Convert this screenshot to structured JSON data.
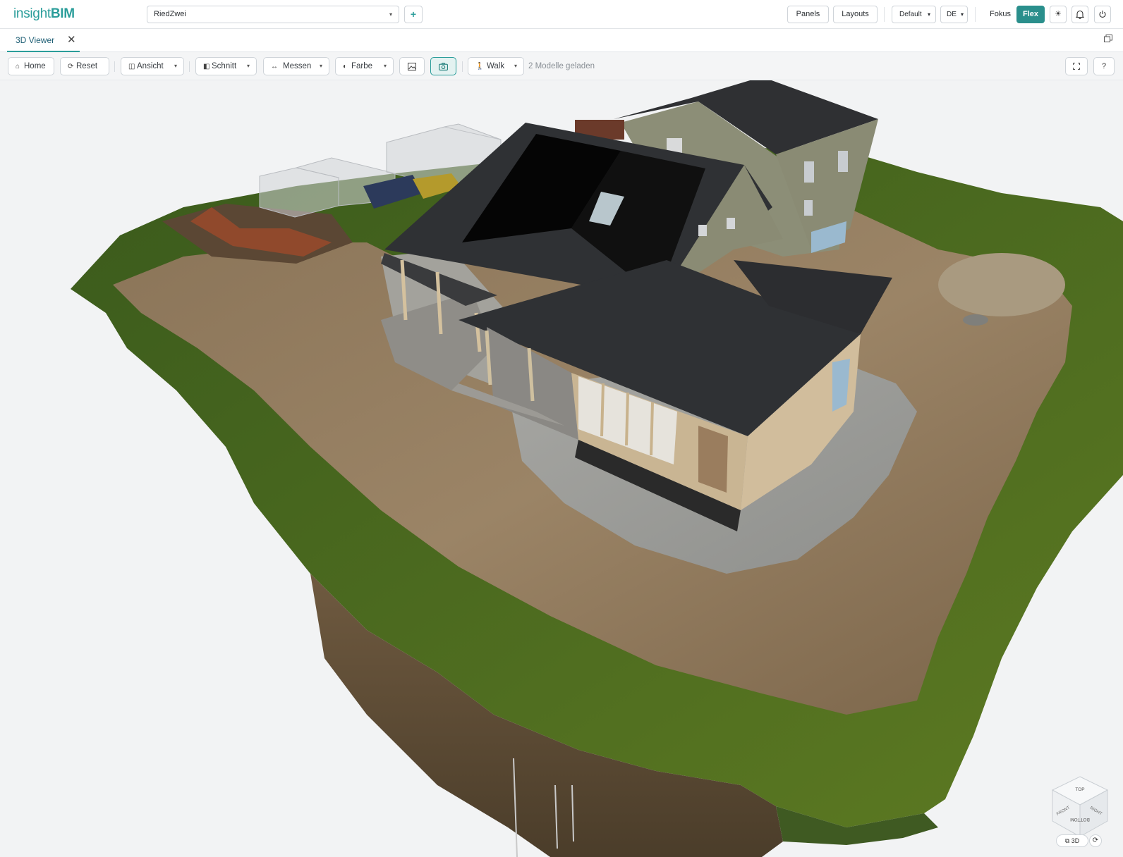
{
  "app": {
    "logo_part1": "insight",
    "logo_part2": "BIM"
  },
  "header": {
    "project_value": "RiedZwei",
    "add_label": "+",
    "panels_label": "Panels",
    "layouts_label": "Layouts",
    "layout_value": "Default",
    "language_value": "DE",
    "mode_fokus": "Fokus",
    "mode_flex": "Flex",
    "icons": [
      "add-icon",
      "theme-sun-icon",
      "bell-icon",
      "power-icon"
    ],
    "accent_color": "#2a9d9a",
    "active_color": "#2a8f8c"
  },
  "tabs": [
    {
      "label": "3D Viewer",
      "active": true
    }
  ],
  "toolbar": {
    "home_label": "Home",
    "reset_label": "Reset",
    "ansicht_label": "Ansicht",
    "schnitt_label": "Schnitt",
    "messen_label": "Messen",
    "farbe_label": "Farbe",
    "walk_label": "Walk",
    "status": "2 Modelle geladen",
    "icons": [
      "home-icon",
      "reset-icon",
      "view-icon",
      "section-icon",
      "measure-icon",
      "color-icon",
      "image-icon",
      "camera-icon",
      "walk-icon",
      "fullscreen-icon",
      "help-icon"
    ]
  },
  "navcube": {
    "faces": [
      "TOP",
      "FRONT",
      "RIGHT",
      "BOTTOM"
    ],
    "mode_label": "3D"
  }
}
